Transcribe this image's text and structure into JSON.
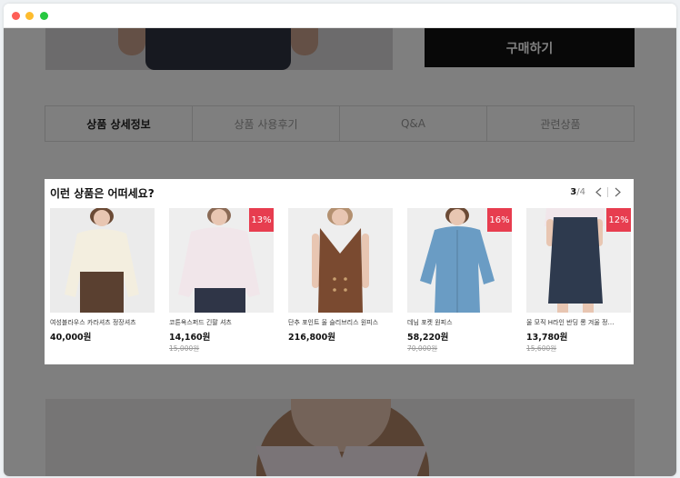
{
  "window": {
    "controls": [
      "close",
      "minimize",
      "maximize"
    ]
  },
  "page": {
    "buy_button": "구매하기",
    "tabs": [
      "상품 상세정보",
      "상품 사용후기",
      "Q&A",
      "관련상품"
    ],
    "active_tab": 0
  },
  "popup": {
    "title": "이런 상품은 어떠세요?",
    "pager": {
      "current": "3",
      "total": "/4"
    },
    "products": [
      {
        "name": "여성블라우스 카라셔츠 정장셔츠",
        "price": "40,000원",
        "original_price": "",
        "discount": ""
      },
      {
        "name": "코튼옥스퍼드 긴팔 셔츠",
        "price": "14,160원",
        "original_price": "15,000원",
        "discount": "13%"
      },
      {
        "name": "단추 포인트 울 슬리브리스 원피스",
        "price": "216,800원",
        "original_price": "",
        "discount": ""
      },
      {
        "name": "데님 포켓 원피스",
        "price": "58,220원",
        "original_price": "70,000원",
        "discount": "16%"
      },
      {
        "name": "울 모직 H라인 반딩 롱 겨울 정…",
        "price": "13,780원",
        "original_price": "15,600원",
        "discount": "12%"
      }
    ]
  },
  "colors": {
    "badge": "#e73d4f",
    "buy_button": "#111111",
    "overlay": "rgba(0,0,0,0.5)"
  },
  "icons": [
    "chevron-left-icon",
    "chevron-right-icon"
  ]
}
